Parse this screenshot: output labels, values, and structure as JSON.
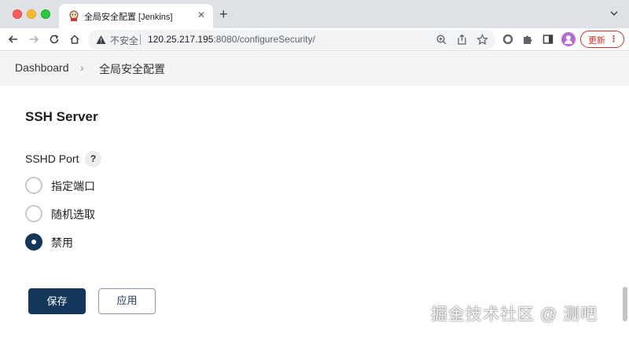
{
  "browser": {
    "tab_title": "全局安全配置 [Jenkins]",
    "tab_close": "✕",
    "new_tab": "+",
    "omnibox": {
      "security_label": "不安全",
      "url_host": "120.25.217.195",
      "url_rest": ":8080/configureSecurity/"
    },
    "update_label": "更新",
    "update_menu": "⋮"
  },
  "breadcrumb": {
    "items": [
      "Dashboard",
      "全局安全配置"
    ],
    "separator": "›"
  },
  "section": {
    "title": "SSH Server",
    "field_label": "SSHD Port",
    "help": "?",
    "options": [
      {
        "label": "指定端口",
        "checked": false
      },
      {
        "label": "随机选取",
        "checked": false
      },
      {
        "label": "禁用",
        "checked": true
      }
    ]
  },
  "buttons": {
    "save": "保存",
    "apply": "应用"
  },
  "watermark": "掘金技术社区 @ 测吧",
  "colors": {
    "primary": "#13365a",
    "breadcrumb_bg": "#f4f4f6",
    "tabstrip_bg": "#dee1e6",
    "update_red": "#d93025"
  }
}
